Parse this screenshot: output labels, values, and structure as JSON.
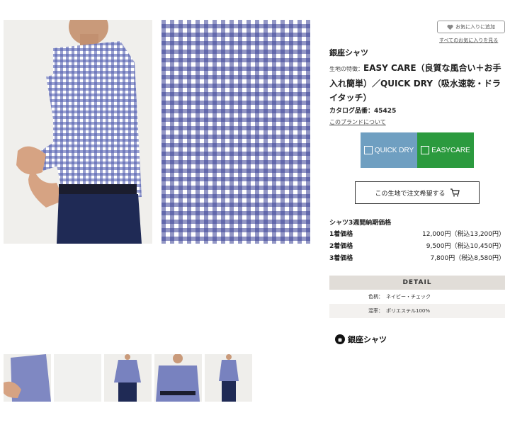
{
  "favorites": {
    "add_label": "お気に入りに追加",
    "view_all_link": "すべてのお気に入りを見る"
  },
  "product": {
    "brand_name": "銀座シャツ",
    "feature_label": "生地の特徴：",
    "feature_text": "EASY CARE（良質な風合い＋お手入れ簡単）／QUICK DRY（吸水速乾・ドライタッチ）",
    "catalog_label": "カタログ品番：",
    "catalog_number": "45425",
    "brand_link": "このブランドについて"
  },
  "badges": {
    "quick_dry": "QUICK DRY",
    "easy_care": "EASYCARE",
    "quick_color": "#6f9fc1",
    "easy_color": "#2b9a3e"
  },
  "order_button": "この生地で注文希望する",
  "pricing": {
    "heading": "シャツ3週間納期価格",
    "rows": [
      {
        "label": "1着価格",
        "price": "12,000円（税込13,200円）"
      },
      {
        "label": "2着価格",
        "price": "9,500円（税込10,450円）"
      },
      {
        "label": "3着価格",
        "price": "7,800円（税込8,580円）"
      }
    ]
  },
  "detail": {
    "heading": "DETAIL",
    "rows": [
      {
        "key": "色柄：",
        "value": "ネイビー・チェック"
      },
      {
        "key": "混率：",
        "value": "ポリエステル100%"
      }
    ]
  },
  "logo_text": "銀座シャツ",
  "icons": [
    "heart-icon",
    "cart-icon",
    "quick-dry-icon",
    "easy-care-icon",
    "logo-mark-icon"
  ]
}
